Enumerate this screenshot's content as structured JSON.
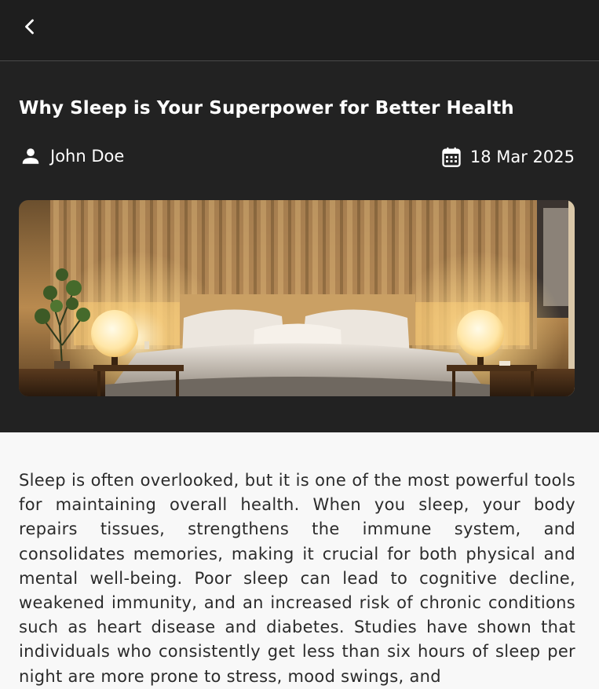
{
  "header": {
    "back_icon": "chevron-left-icon"
  },
  "article": {
    "title": "Why Sleep is Your Superpower for Better Health",
    "author": "John Doe",
    "author_icon": "person-icon",
    "date": "18 Mar 2025",
    "date_icon": "calendar-icon",
    "body": "Sleep is often overlooked, but it is one of the most powerful tools for maintaining overall health. When you sleep, your body repairs tissues, strengthens the immune system, and consolidates memories, making it crucial for both physical and mental well-being. Poor sleep can lead to cognitive decline, weakened immunity, and an increased risk of chronic conditions such as heart disease and diabetes. Studies have shown that individuals who consistently get less than six hours of sleep per night are more prone to stress, mood swings, and"
  },
  "colors": {
    "header_bg": "#1e1e1e",
    "hero_bg": "#222222",
    "body_bg": "#f8f8f8",
    "text_light": "#ffffff",
    "text_dark": "#2b2b2b",
    "lamp_glow": "#ffd98a"
  }
}
